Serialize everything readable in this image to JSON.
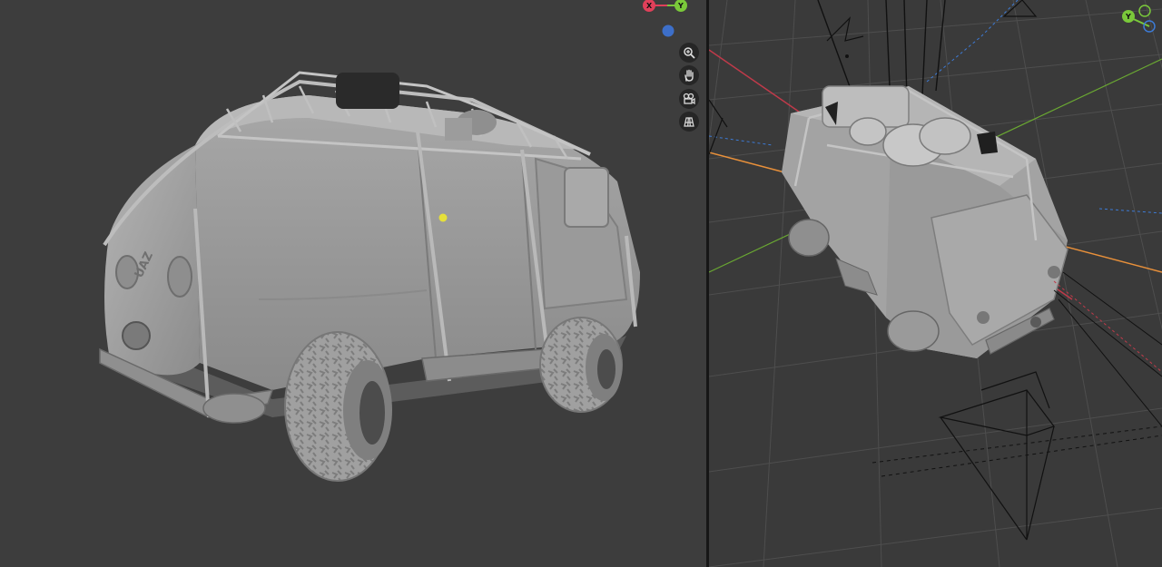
{
  "viewport_left": {
    "gizmo": {
      "x_label": "X",
      "y_label": "Y"
    },
    "model_text": "UAZ",
    "nav_buttons": [
      {
        "name": "zoom-button",
        "icon": "zoom-icon"
      },
      {
        "name": "pan-button",
        "icon": "hand-pan-icon"
      },
      {
        "name": "camera-view-button",
        "icon": "camera-icon"
      },
      {
        "name": "ortho-toggle-button",
        "icon": "grid-icon"
      }
    ]
  },
  "viewport_right": {
    "gizmo": {
      "y_label": "Y"
    }
  },
  "colors": {
    "background": "#3d3d3d",
    "axis_x": "#e0405a",
    "axis_y": "#7ac93a",
    "axis_z": "#3d7bd6",
    "selection_orange": "#e8903a",
    "model_grey": "#a3a3a3"
  }
}
